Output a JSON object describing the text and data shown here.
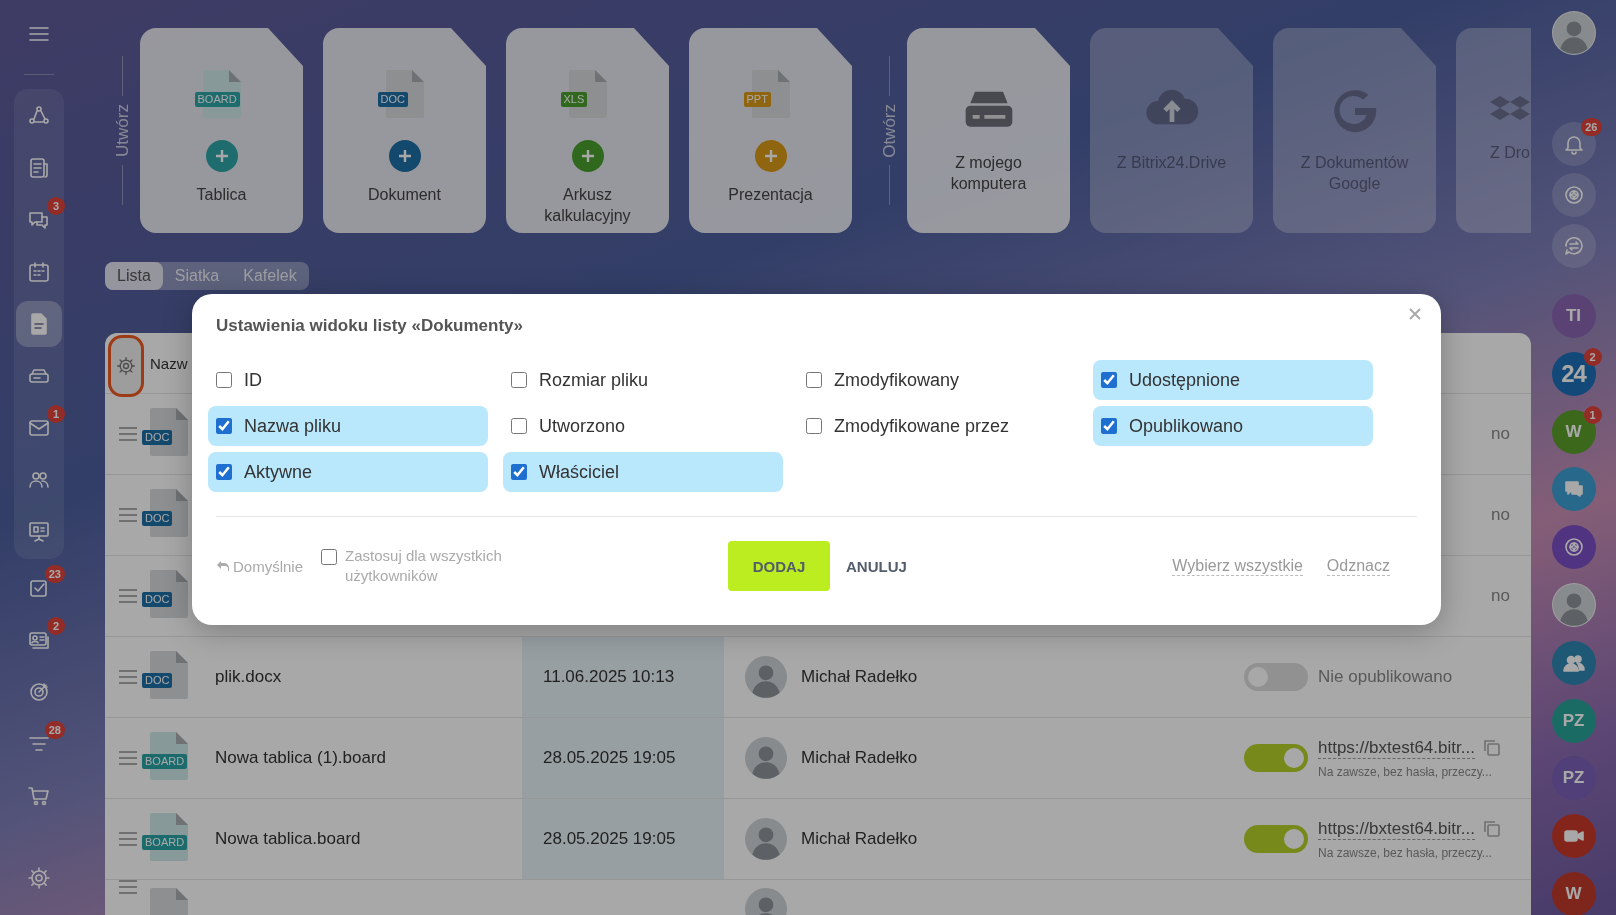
{
  "left_bar": {
    "pinned": [
      {
        "kind": "flow",
        "selected": false
      },
      {
        "kind": "news",
        "selected": false
      },
      {
        "kind": "chat",
        "badge": "3",
        "selected": false
      },
      {
        "kind": "calendar",
        "selected": false
      },
      {
        "kind": "docs",
        "selected": true
      },
      {
        "kind": "drive",
        "selected": false
      },
      {
        "kind": "mail",
        "badge": "1",
        "selected": false
      },
      {
        "kind": "people",
        "selected": false
      },
      {
        "kind": "board",
        "selected": false
      }
    ],
    "items": [
      {
        "kind": "tasks",
        "badge": "23",
        "selected": false
      },
      {
        "kind": "crm",
        "badge": "2",
        "selected": false
      },
      {
        "kind": "target",
        "selected": false
      },
      {
        "kind": "funnel",
        "badge": "28",
        "selected": false
      },
      {
        "kind": "cart",
        "selected": false
      }
    ],
    "footer": [
      {
        "kind": "settings",
        "selected": false
      }
    ]
  },
  "create": {
    "label": "Utwórz",
    "tiles": [
      {
        "kind": "board",
        "type_label": "BOARD",
        "label": "Tablica"
      },
      {
        "kind": "doc",
        "type_label": "DOC",
        "label": "Dokument"
      },
      {
        "kind": "xls",
        "type_label": "XLS",
        "label": "Arkusz kalkulacyjny"
      },
      {
        "kind": "ppt",
        "type_label": "PPT",
        "label": "Prezentacja"
      }
    ]
  },
  "open": {
    "label": "Otwórz",
    "tiles": [
      {
        "kind": "computer",
        "label": "Z mojego komputera",
        "disabled": false
      },
      {
        "kind": "cloud",
        "label": "Z Bitrix24.Drive",
        "disabled": true
      },
      {
        "kind": "google",
        "label": "Z Dokumentów Google",
        "disabled": true
      },
      {
        "kind": "dropbox",
        "label": "Z Dro",
        "disabled": true
      }
    ]
  },
  "view_tabs": [
    {
      "label": "Lista",
      "selected": true
    },
    {
      "label": "Siatka",
      "selected": false
    },
    {
      "label": "Kafelek",
      "selected": false
    }
  ],
  "table": {
    "column_1": "Nazw",
    "rows": [
      {
        "kind": "covered",
        "type_label": "DOC",
        "status": "no"
      },
      {
        "kind": "covered",
        "type_label": "DOC",
        "status": "no"
      },
      {
        "kind": "covered",
        "type_label": "DOC",
        "status": "no"
      },
      {
        "kind": "full",
        "type_label": "DOC",
        "name": "plik.docx",
        "date": "11.06.2025 10:13",
        "owner": "Michał Radełko",
        "published": false,
        "status": "Nie opublikowano"
      },
      {
        "kind": "full",
        "type_label": "BOARD",
        "name": "Nowa tablica (1).board",
        "date": "28.05.2025 19:05",
        "owner": "Michał Radełko",
        "published": true,
        "link": "https://bxtest64.bitr...",
        "link_note": "Na zawsze, bez hasła, przeczy..."
      },
      {
        "kind": "full",
        "type_label": "BOARD",
        "name": "Nowa tablica.board",
        "date": "28.05.2025 19:05",
        "owner": "Michał Radełko",
        "published": true,
        "link": "https://bxtest64.bitr...",
        "link_note": "Na zawsze, bez hasła, przeczy..."
      },
      {
        "kind": "cut"
      }
    ]
  },
  "dialog": {
    "title": "Ustawienia widoku listy «Dokumenty»",
    "options": [
      {
        "label": "ID",
        "checked": false
      },
      {
        "label": "Rozmiar pliku",
        "checked": false
      },
      {
        "label": "Zmodyfikowany",
        "checked": false
      },
      {
        "label": "Udostępnione",
        "checked": true
      },
      {
        "label": "Nazwa pliku",
        "checked": true
      },
      {
        "label": "Utworzono",
        "checked": false
      },
      {
        "label": "Zmodyfikowane przez",
        "checked": false
      },
      {
        "label": "Opublikowano",
        "checked": true
      },
      {
        "label": "Aktywne",
        "checked": true
      },
      {
        "label": "Właściciel",
        "checked": true
      }
    ],
    "default_link": "Domyślnie",
    "apply_all": {
      "label": "Zastosuj dla wszystkich użytkowników",
      "checked": false
    },
    "buttons": [
      {
        "label": "DODAJ",
        "kind": "primary"
      },
      {
        "label": "ANULUJ",
        "kind": "secondary"
      }
    ],
    "links": [
      "Wybierz wszystkie",
      "Odznacz"
    ]
  },
  "right_bar": {
    "top": [
      {
        "kind": "photo"
      },
      {
        "kind": "bell",
        "badge": "26"
      },
      {
        "kind": "copilot"
      },
      {
        "kind": "swap"
      }
    ],
    "apps": [
      {
        "kind": "initials",
        "text": "TI"
      },
      {
        "kind": "initials",
        "text": "24",
        "badge": "2"
      },
      {
        "kind": "initials",
        "text": "W",
        "badge": "1"
      },
      {
        "kind": "chat"
      },
      {
        "kind": "copilot"
      },
      {
        "kind": "photo"
      },
      {
        "kind": "group"
      },
      {
        "kind": "initials",
        "text": "PZ"
      },
      {
        "kind": "initials",
        "text": "PZ"
      },
      {
        "kind": "video"
      },
      {
        "kind": "initials",
        "text": "W"
      }
    ]
  }
}
